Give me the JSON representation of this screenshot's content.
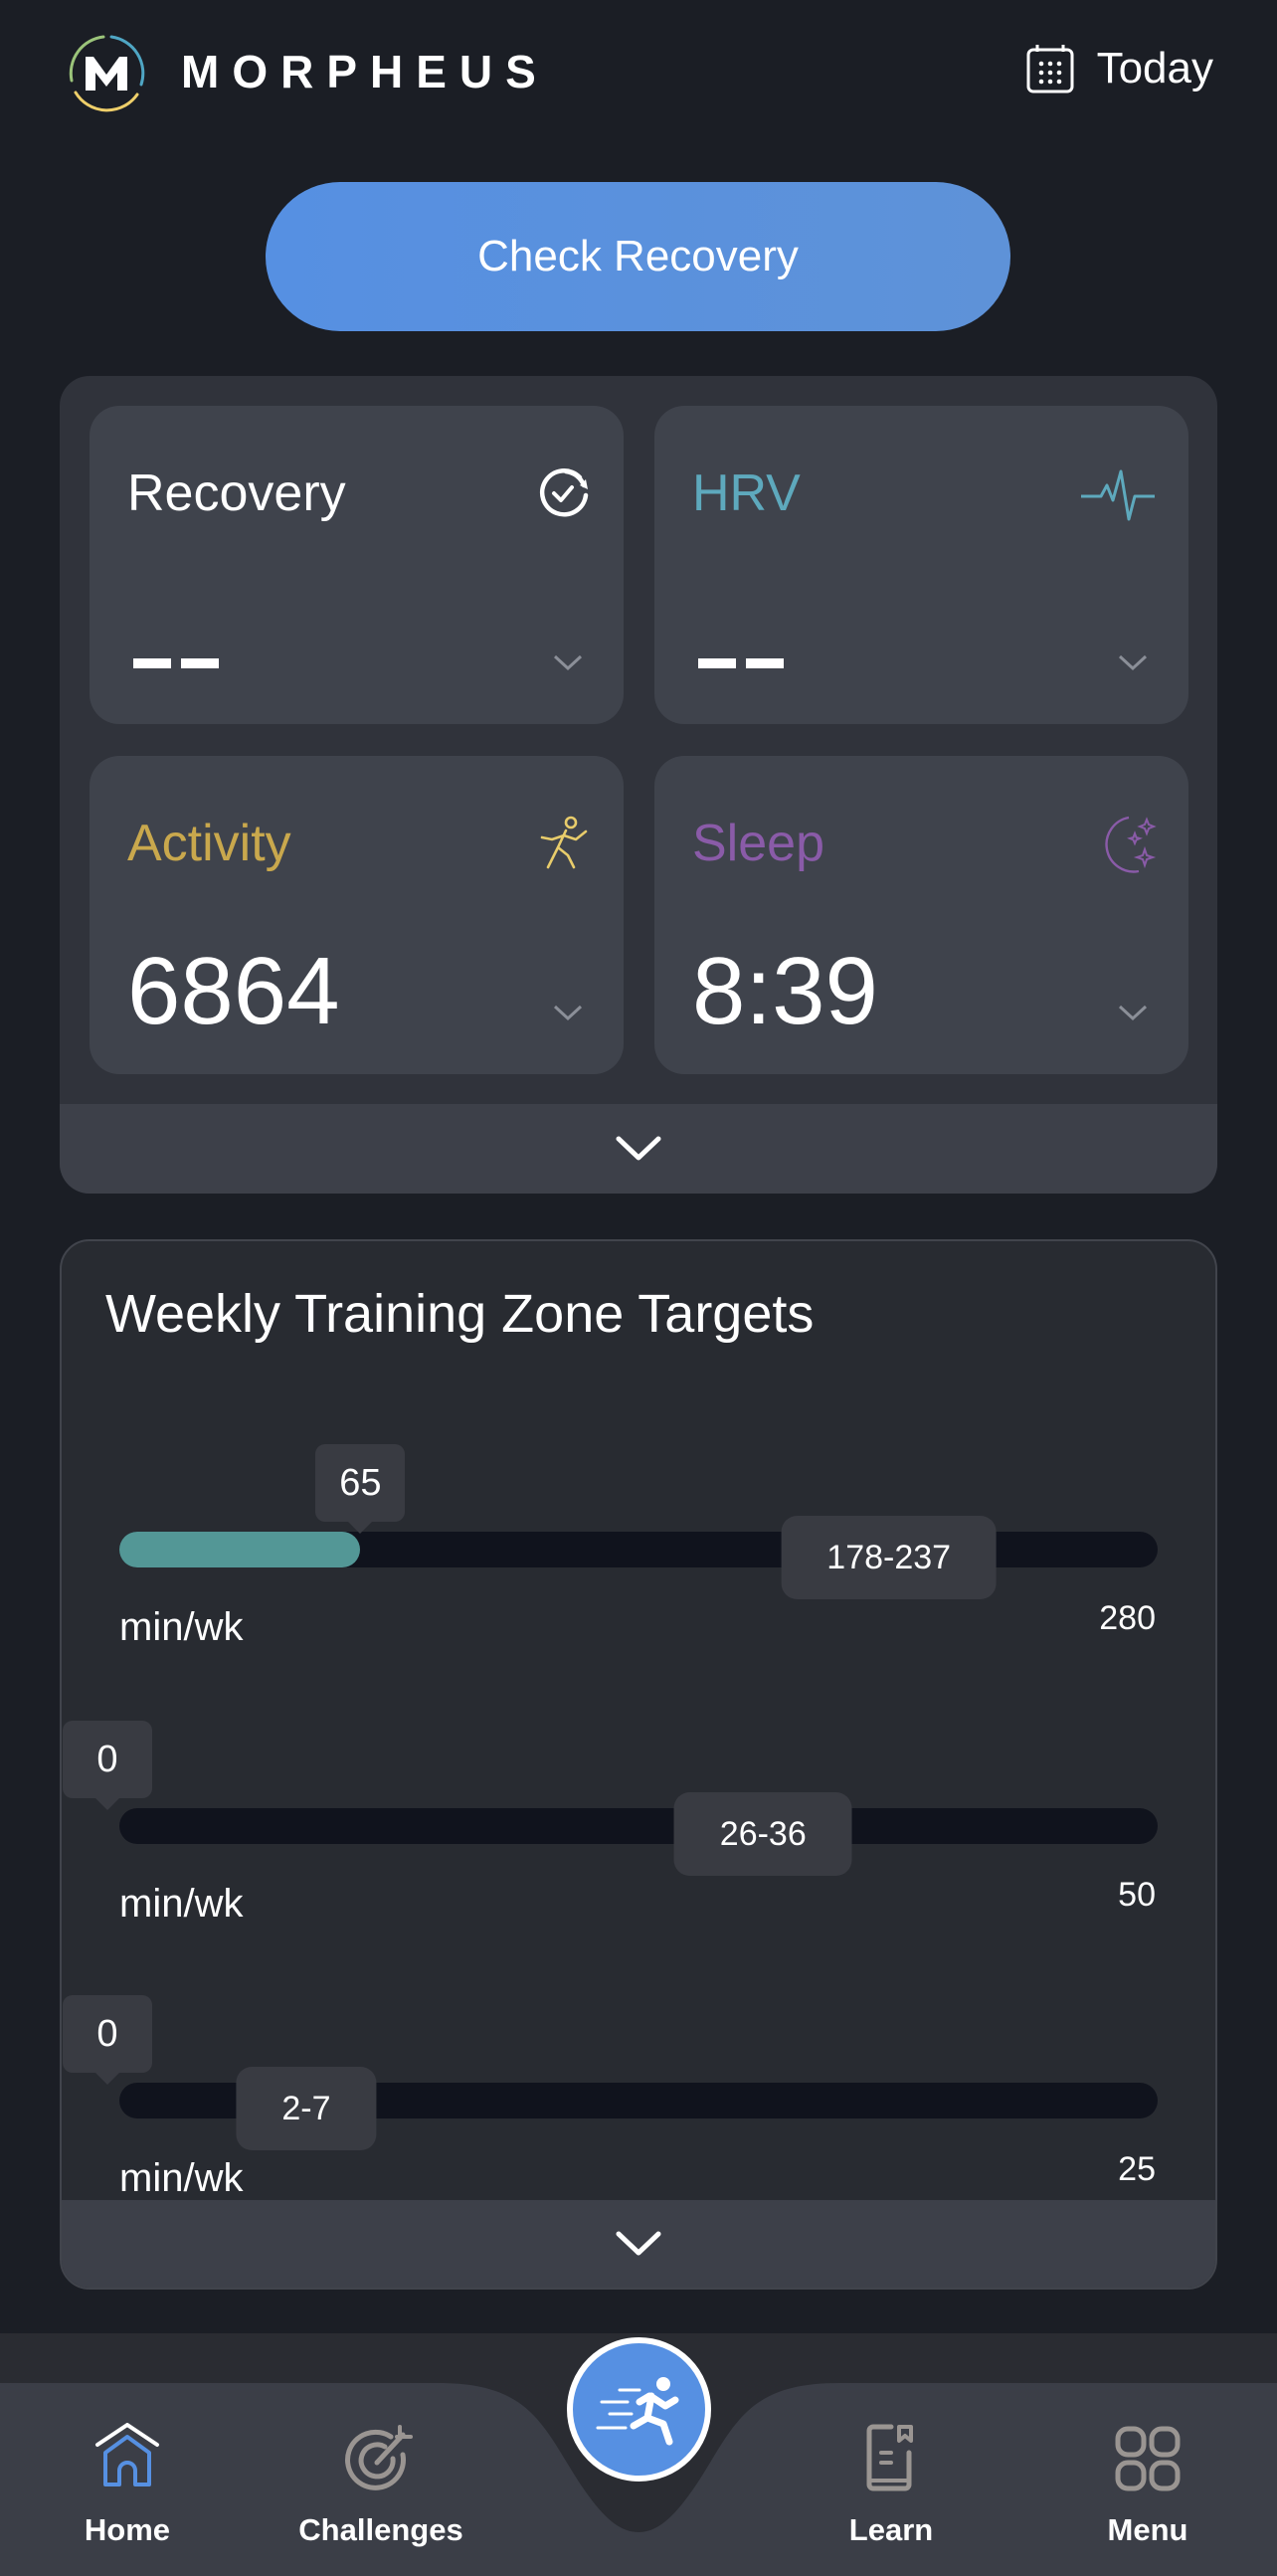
{
  "header": {
    "brand": "MORPHEUS",
    "logo_letter": "M",
    "date_label": "Today",
    "date_icon": "calendar-icon"
  },
  "check_recovery": {
    "label": "Check Recovery"
  },
  "metrics": {
    "recovery": {
      "title": "Recovery",
      "value": "--",
      "icon": "recovery-check-icon",
      "color": "#ffffff"
    },
    "hrv": {
      "title": "HRV",
      "value": "--",
      "icon": "heartbeat-icon",
      "color": "#5ea9bd"
    },
    "activity": {
      "title": "Activity",
      "value": "6864",
      "icon": "running-person-icon",
      "color": "#c9a84d"
    },
    "sleep": {
      "title": "Sleep",
      "value": "8:39",
      "icon": "moon-stars-icon",
      "color": "#8a5ba8"
    },
    "expand_icon": "chevron-down-icon"
  },
  "training_zones": {
    "title": "Weekly Training Zone Targets",
    "zones": [
      {
        "current": "65",
        "current_value": 65,
        "target": "178-237",
        "target_low": 178,
        "target_high": 237,
        "max": "280",
        "max_value": 280,
        "unit": "min/wk"
      },
      {
        "current": "0",
        "current_value": 0,
        "target": "26-36",
        "target_low": 26,
        "target_high": 36,
        "max": "50",
        "max_value": 50,
        "unit": "min/wk"
      },
      {
        "current": "0",
        "current_value": 0,
        "target": "2-7",
        "target_low": 2,
        "target_high": 7,
        "max": "25",
        "max_value": 25,
        "unit": "min/wk"
      }
    ],
    "fill_color": "#539796"
  },
  "bottom_nav": {
    "items": [
      {
        "label": "Home",
        "icon": "home-icon",
        "active": true
      },
      {
        "label": "Challenges",
        "icon": "target-icon",
        "active": false
      },
      {
        "label": "Learn",
        "icon": "book-icon",
        "active": false
      },
      {
        "label": "Menu",
        "icon": "grid-icon",
        "active": false
      }
    ],
    "center_action_icon": "running-fast-icon",
    "accent": "#5690e2"
  }
}
